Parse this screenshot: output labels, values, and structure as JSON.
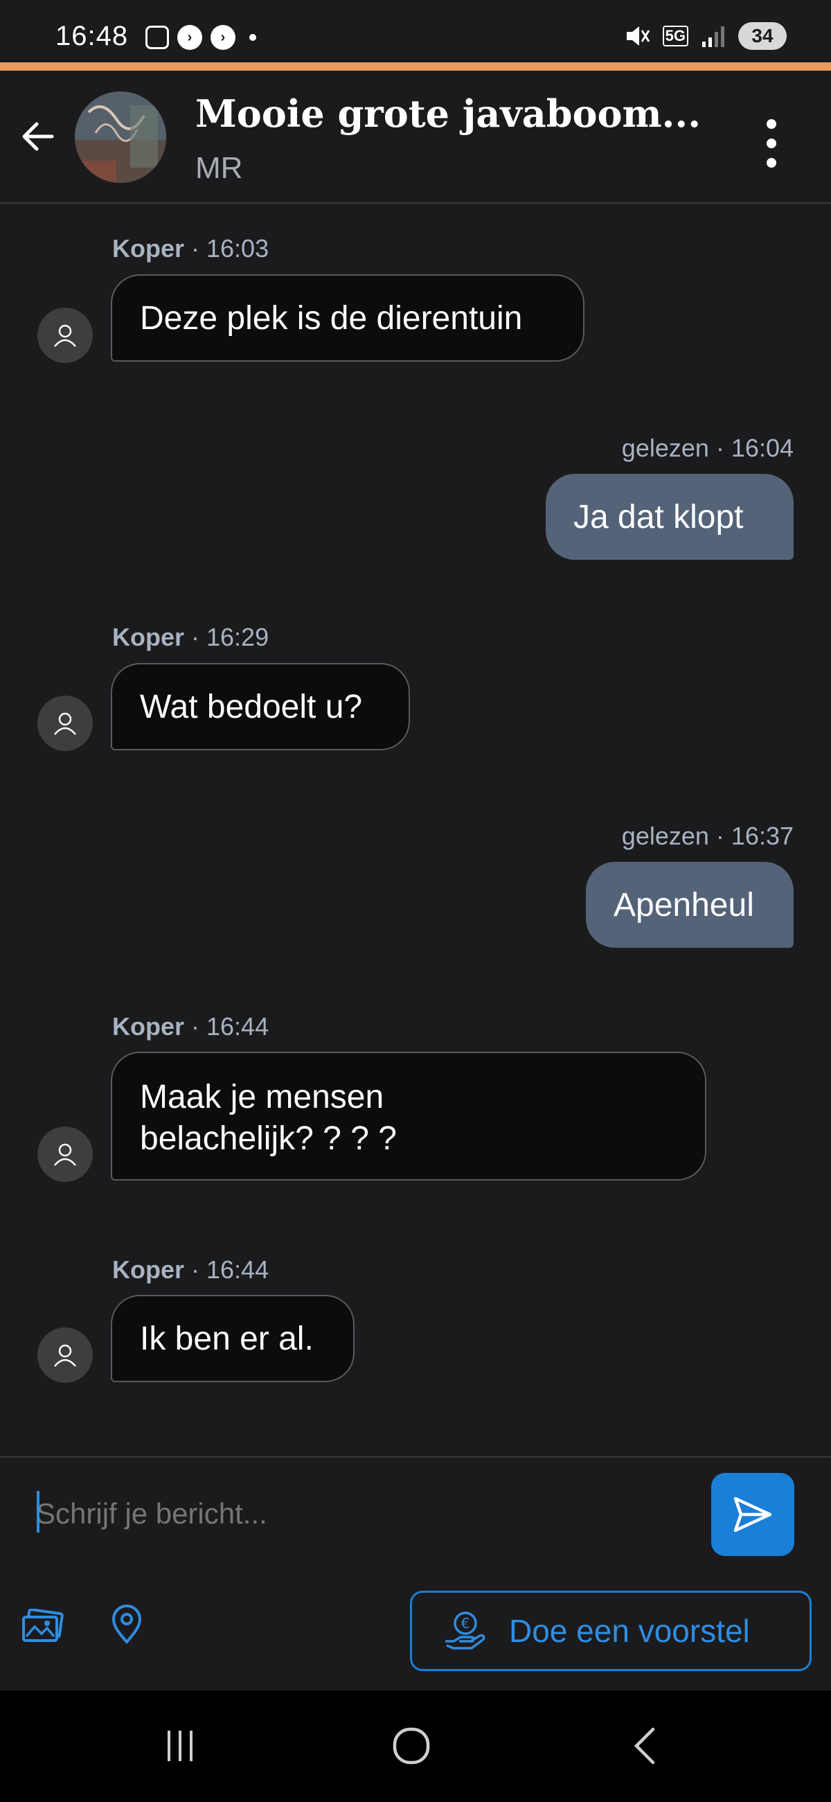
{
  "status_bar": {
    "time": "16:48",
    "network": "5G",
    "battery": "34"
  },
  "header": {
    "title": "Mooie grote javaboom...",
    "subtitle": "MR",
    "back_icon": "arrow-left-icon",
    "menu_icon": "more-vertical-icon"
  },
  "messages": [
    {
      "direction": "in",
      "sender": "Koper",
      "time": "16:03",
      "text": "Deze plek is de dierentuin"
    },
    {
      "direction": "out",
      "status": "gelezen",
      "time": "16:04",
      "text": "Ja dat klopt"
    },
    {
      "direction": "in",
      "sender": "Koper",
      "time": "16:29",
      "text": "Wat bedoelt u?"
    },
    {
      "direction": "out",
      "status": "gelezen",
      "time": "16:37",
      "text": "Apenheul"
    },
    {
      "direction": "in",
      "sender": "Koper",
      "time": "16:44",
      "text_line1": "Maak je mensen",
      "text_line2": "belachelijk? ? ? ?"
    },
    {
      "direction": "in",
      "sender": "Koper",
      "time": "16:44",
      "text": "Ik ben er al."
    }
  ],
  "composer": {
    "placeholder": "Schrijf je bericht...",
    "send_icon": "send-icon"
  },
  "toolbar": {
    "photo_icon": "images-icon",
    "location_icon": "location-pin-icon",
    "offer_label": "Doe een voorstel",
    "offer_icon": "euro-hand-icon"
  },
  "colors": {
    "background": "#1b1b1d",
    "accent": "#1a7fd6",
    "outgoing_bubble": "#546378",
    "incoming_bubble": "#0c0c0c",
    "top_accent": "#e69a5e"
  }
}
